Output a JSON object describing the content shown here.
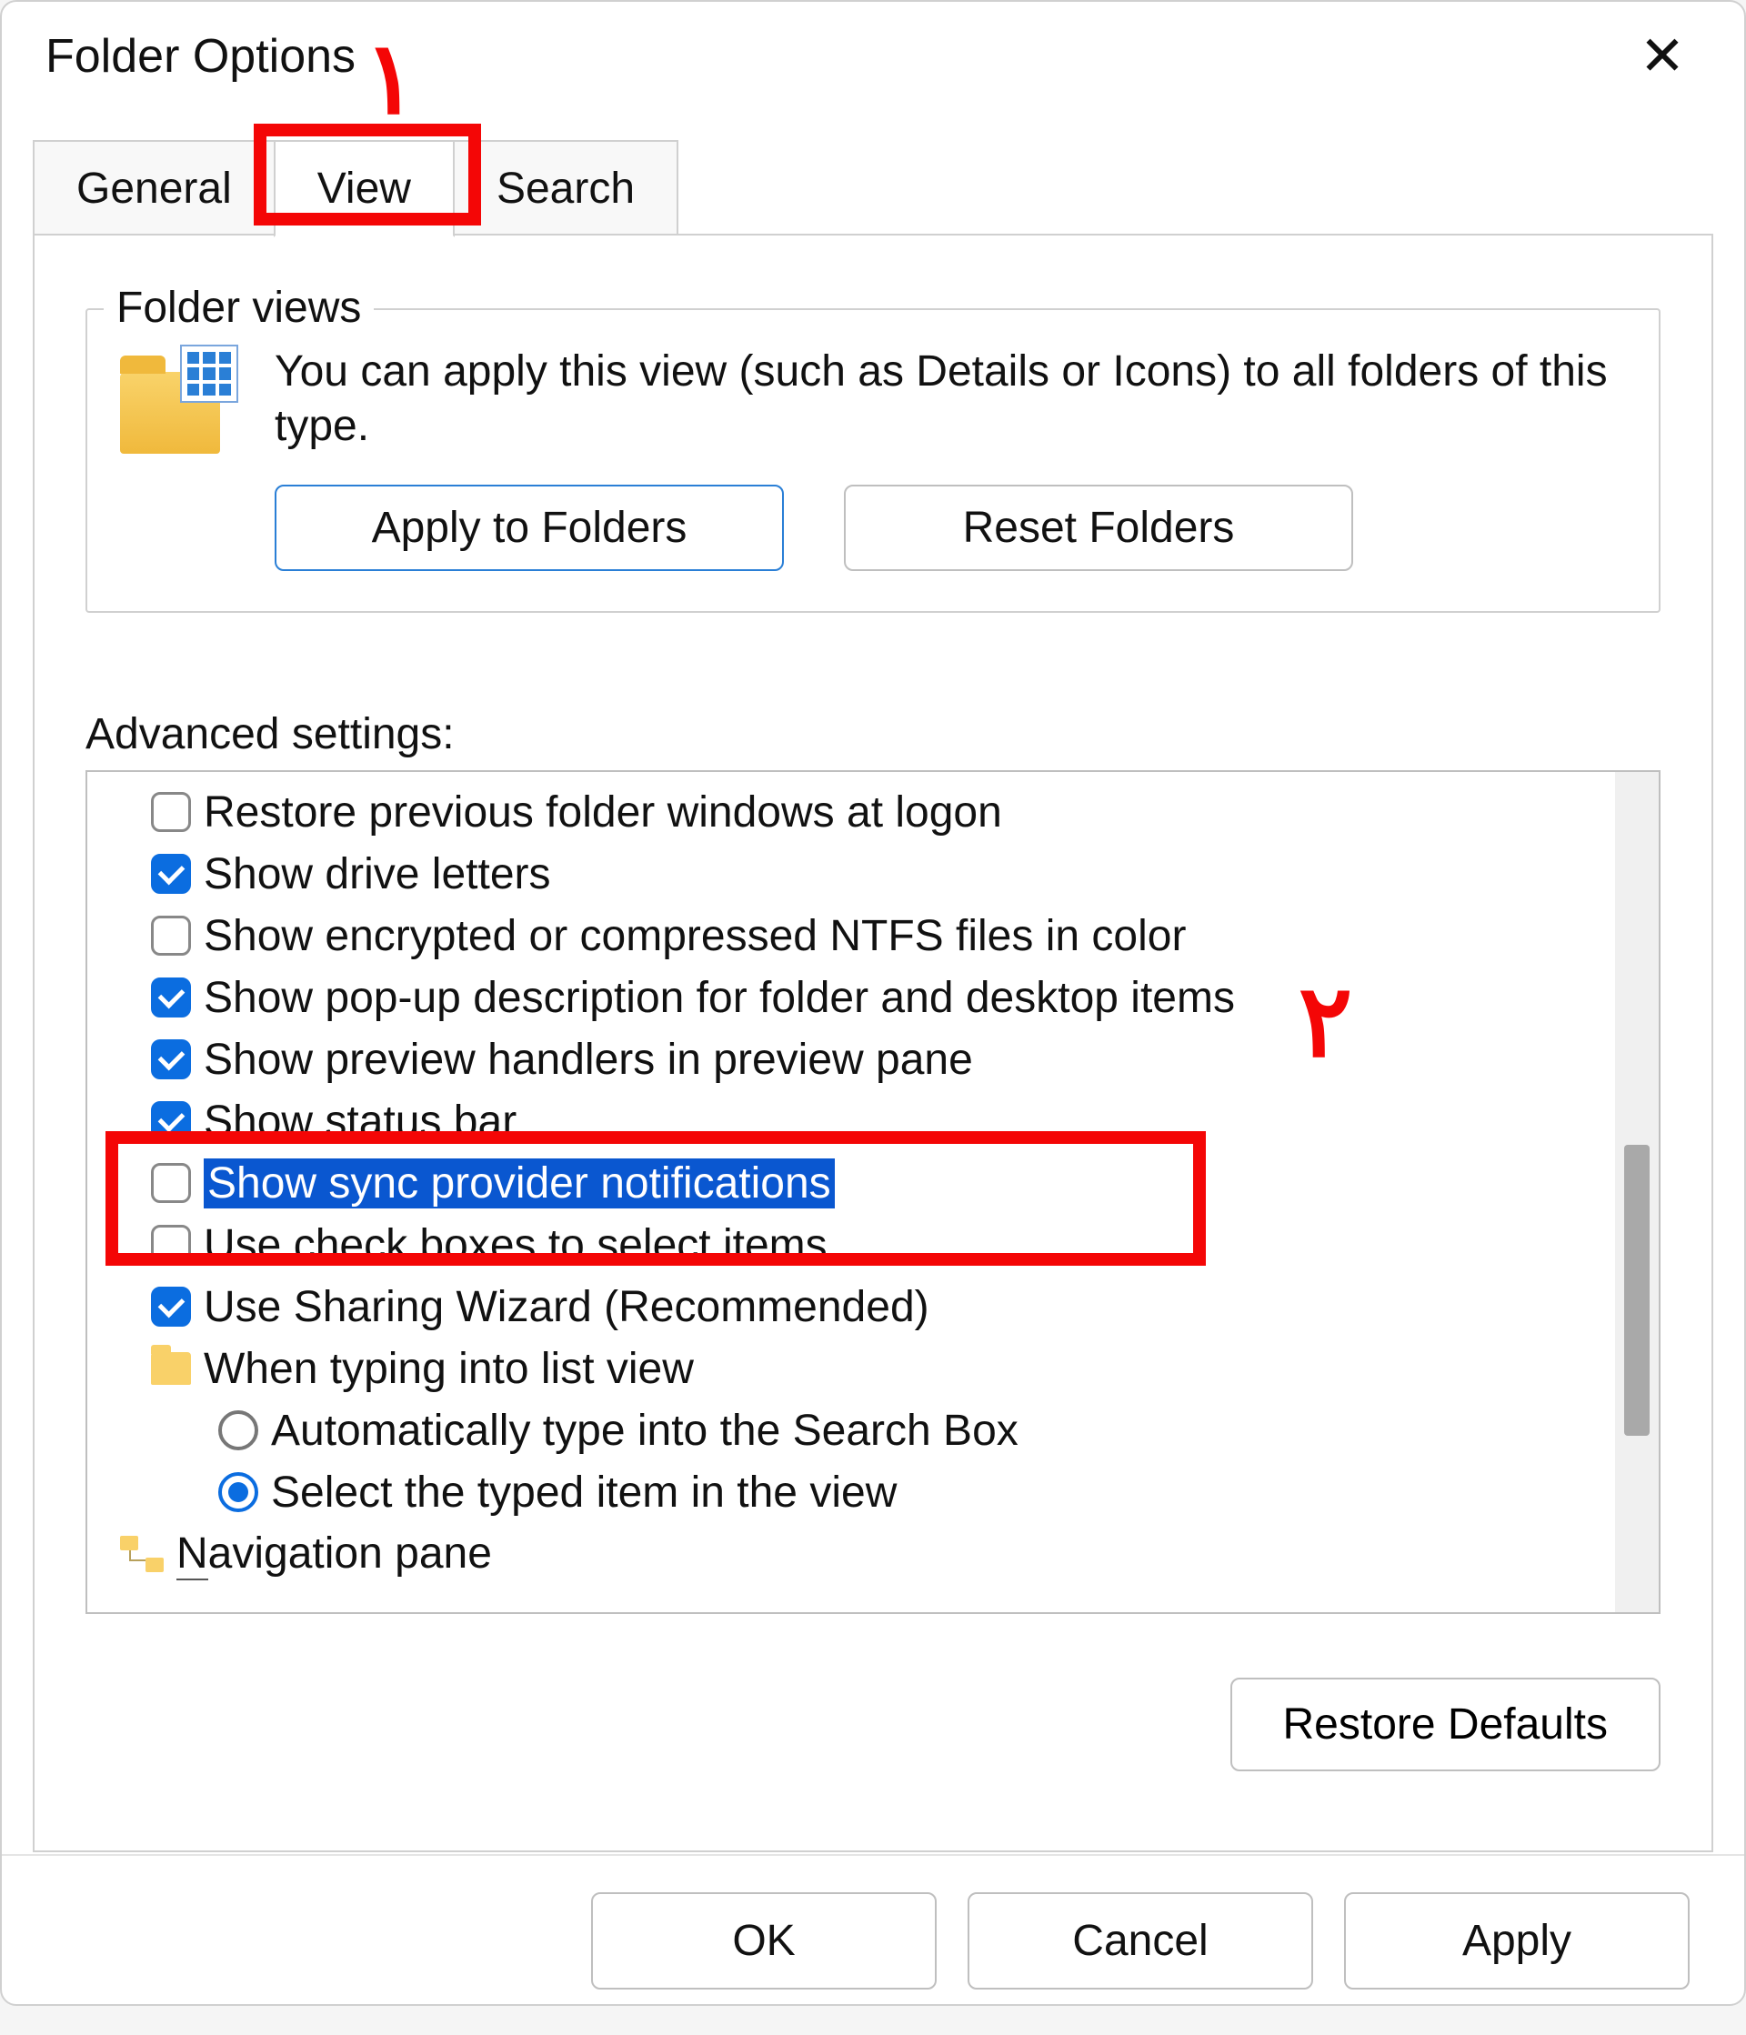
{
  "dialog": {
    "title": "Folder Options"
  },
  "tabs": {
    "general": "General",
    "view": "View",
    "search": "Search",
    "active": "view"
  },
  "folder_views": {
    "legend": "Folder views",
    "description": "You can apply this view (such as Details or Icons) to all folders of this type.",
    "apply_btn": "Apply to Folders",
    "reset_btn": "Reset Folders"
  },
  "advanced": {
    "label": "Advanced settings:",
    "items": {
      "restore_prev": "Restore previous folder windows at logon",
      "drive_letters": "Show drive letters",
      "ntfs_color": "Show encrypted or compressed NTFS files in color",
      "popup_desc": "Show pop-up description for folder and desktop items",
      "preview_handlers": "Show preview handlers in preview pane",
      "status_bar": "Show status bar",
      "sync_provider": "Show sync provider notifications",
      "checkboxes": "Use check boxes to select items",
      "sharing_wizard": "Use Sharing Wizard (Recommended)",
      "typing_group": "When typing into list view",
      "typing_search": "Automatically type into the Search Box",
      "typing_select": "Select the typed item in the view",
      "nav_pane": "avigation pane",
      "nav_pane_prefix": "N"
    }
  },
  "restore_defaults": "Restore Defaults",
  "footer": {
    "ok": "OK",
    "cancel": "Cancel",
    "apply": "Apply"
  },
  "annotations": {
    "num1": "۱",
    "num2": "۲"
  }
}
